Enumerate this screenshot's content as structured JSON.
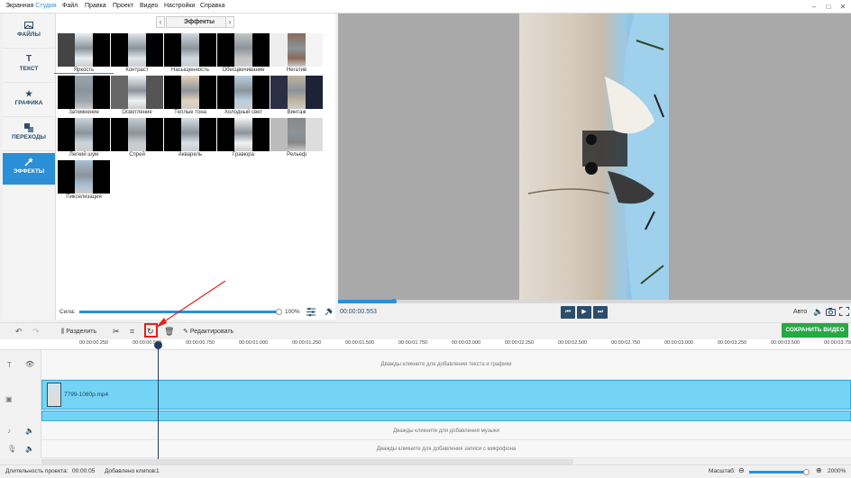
{
  "app": {
    "title_prefix": "Экранная ",
    "title_accent": "Студия"
  },
  "menu": [
    "Файл",
    "Правка",
    "Проект",
    "Видео",
    "Настройки",
    "Справка"
  ],
  "window_controls": [
    "–",
    "□",
    "✕"
  ],
  "sidebar": {
    "items": [
      {
        "label": "ФАЙЛЫ",
        "icon": "image-icon"
      },
      {
        "label": "ТЕКСТ",
        "icon": "text-icon"
      },
      {
        "label": "ГРАФИКА",
        "icon": "star-icon"
      },
      {
        "label": "ПЕРЕХОДЫ",
        "icon": "transitions-icon"
      },
      {
        "label": "ЭФФЕКТЫ",
        "icon": "wand-icon"
      }
    ],
    "active_index": 4
  },
  "effects": {
    "header": "Эффекты",
    "items": [
      "Яркость",
      "Контраст",
      "Насыщенность",
      "Обесцвечивание",
      "Негатив",
      "Затемнение",
      "Осветление",
      "Тёплые тона",
      "Холодный свет",
      "Винтаж",
      "Легкий шум",
      "Спрей",
      "Акварель",
      "Гравюра",
      "Рельеф",
      "Пикселизация"
    ],
    "selected_index": 0,
    "strength_label": "Сила:",
    "strength_value": "100%",
    "strength_fraction": 1.0
  },
  "player": {
    "time": "00:00:00.553",
    "progress_fraction": 0.107,
    "mode": "Авто"
  },
  "toolbar": {
    "split_label": "Разделить",
    "edit_label": "Редактировать",
    "save_label": "СОХРАНИТЬ ВИДЕО"
  },
  "ruler": {
    "ticks": [
      "00:00:00.250",
      "00:00:00.500",
      "00:00:00.750",
      "00:00:01.000",
      "00:00:01.250",
      "00:00:01.500",
      "00:00:01.750",
      "00:00:02.000",
      "00:00:02.250",
      "00:00:02.500",
      "00:00:02.750",
      "00:00:03.000",
      "00:00:03.250",
      "00:00:03.500",
      "00:00:03.750"
    ]
  },
  "timeline": {
    "text_hint": "Дважды кликните для добавления текста и графики",
    "clip_name": "7799-1080p.mp4",
    "music_hint": "Дважды кликните для добавления музыки",
    "mic_hint": "Дважды кликните для добавления записи с микрофона"
  },
  "status": {
    "duration_label": "Длительность проекта:",
    "duration_value": "00:00:05",
    "clips_label": "Добавлено клипов:",
    "clips_value": "1",
    "zoom_label": "Масштаб:",
    "zoom_value": "2000%"
  },
  "colors": {
    "accent": "#2a8fd6",
    "save": "#27a845",
    "clip": "#74d4f5",
    "highlight": "#e02020"
  }
}
